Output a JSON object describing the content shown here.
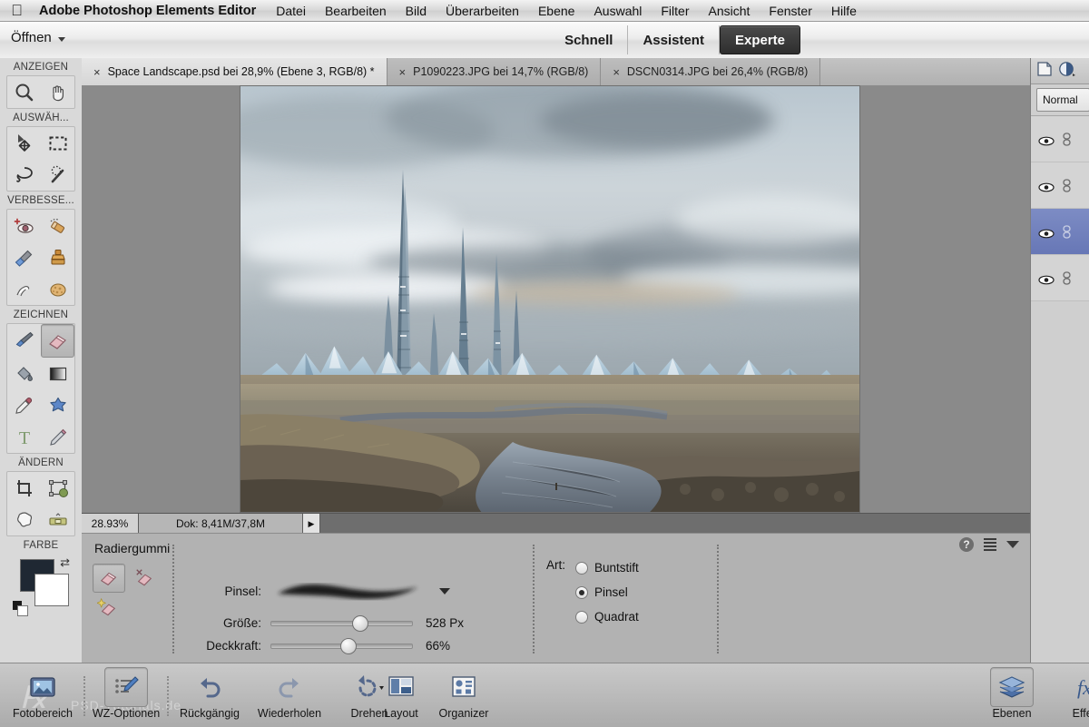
{
  "macmenu": {
    "apple_icon": "apple-icon",
    "app_name": "Adobe Photoshop Elements Editor",
    "items": [
      "Datei",
      "Bearbeiten",
      "Bild",
      "Überarbeiten",
      "Ebene",
      "Auswahl",
      "Filter",
      "Ansicht",
      "Fenster",
      "Hilfe"
    ]
  },
  "modebar": {
    "open_label": "Öffnen",
    "modes": [
      {
        "label": "Schnell",
        "active": false
      },
      {
        "label": "Assistent",
        "active": false
      },
      {
        "label": "Experte",
        "active": true
      }
    ]
  },
  "tabs": [
    {
      "close": "×",
      "label": "Space Landscape.psd bei 28,9% (Ebene 3, RGB/8) *",
      "active": true
    },
    {
      "close": "×",
      "label": "P1090223.JPG bei 14,7% (RGB/8)",
      "active": false
    },
    {
      "close": "×",
      "label": "DSCN0314.JPG bei 26,4% (RGB/8)",
      "active": false
    }
  ],
  "toolbox": {
    "sections": [
      {
        "title": "ANZEIGEN",
        "tools": [
          {
            "name": "zoom-tool",
            "selected": false
          },
          {
            "name": "hand-tool",
            "selected": false
          }
        ]
      },
      {
        "title": "AUSWÄH...",
        "tools": [
          {
            "name": "move-tool",
            "selected": false
          },
          {
            "name": "rectangular-marquee-tool",
            "selected": false
          },
          {
            "name": "lasso-tool",
            "selected": false
          },
          {
            "name": "magic-wand-tool",
            "selected": false
          }
        ]
      },
      {
        "title": "VERBESSE...",
        "tools": [
          {
            "name": "red-eye-tool",
            "selected": false
          },
          {
            "name": "spot-healing-tool",
            "selected": false
          },
          {
            "name": "smart-brush-tool",
            "selected": false
          },
          {
            "name": "clone-stamp-tool",
            "selected": false
          },
          {
            "name": "blur-tool",
            "selected": false
          },
          {
            "name": "sponge-tool",
            "selected": false
          }
        ]
      },
      {
        "title": "ZEICHNEN",
        "tools": [
          {
            "name": "brush-tool",
            "selected": false
          },
          {
            "name": "eraser-tool",
            "selected": true
          },
          {
            "name": "paint-bucket-tool",
            "selected": false
          },
          {
            "name": "gradient-tool",
            "selected": false
          },
          {
            "name": "eyedropper-tool",
            "selected": false
          },
          {
            "name": "custom-shape-tool",
            "selected": false
          },
          {
            "name": "type-tool",
            "selected": false
          },
          {
            "name": "pencil-tool",
            "selected": false
          }
        ]
      },
      {
        "title": "ÄNDERN",
        "tools": [
          {
            "name": "crop-tool",
            "selected": false
          },
          {
            "name": "recompose-tool",
            "selected": false
          },
          {
            "name": "cookie-cutter-tool",
            "selected": false
          },
          {
            "name": "straighten-tool",
            "selected": false
          }
        ]
      }
    ],
    "color_section_title": "FARBE",
    "foreground_color": "#1f2833",
    "background_color": "#ffffff",
    "swap_icon": "swap-colors-icon",
    "default_colors_icon": "default-colors-icon"
  },
  "statusbar": {
    "zoom": "28.93%",
    "doc_info": "Dok: 8,41M/37,8M",
    "expand_icon": "play-arrow-icon"
  },
  "options": {
    "title": "Radiergummi",
    "mode_icons": [
      {
        "name": "eraser-mode-icon",
        "selected": true
      },
      {
        "name": "background-eraser-mode-icon",
        "selected": false
      },
      {
        "name": "magic-eraser-mode-icon",
        "selected": false
      }
    ],
    "brush_label": "Pinsel:",
    "brush_dropdown_icon": "chevron-down-icon",
    "size_label": "Größe:",
    "size_value": "528 Px",
    "size_percent": 62,
    "opacity_label": "Deckkraft:",
    "opacity_value": "66%",
    "opacity_percent": 56,
    "art_label": "Art:",
    "art_options": [
      {
        "label": "Buntstift",
        "checked": false
      },
      {
        "label": "Pinsel",
        "checked": true
      },
      {
        "label": "Quadrat",
        "checked": false
      }
    ],
    "panel_icons": [
      {
        "name": "help-icon",
        "glyph": "?"
      },
      {
        "name": "panel-menu-icon"
      },
      {
        "name": "collapse-chevron-icon"
      }
    ]
  },
  "layers": {
    "new_layer_icon": "new-layer-icon",
    "adjustment-layer_icon": "adjustment-layer-icon",
    "blend_mode": "Normal",
    "rows": [
      {
        "name": "layer-row-1",
        "visible": true,
        "linked": true,
        "selected": false
      },
      {
        "name": "layer-row-2",
        "visible": true,
        "linked": true,
        "selected": false
      },
      {
        "name": "layer-row-3",
        "visible": true,
        "linked": true,
        "selected": true
      },
      {
        "name": "layer-row-4",
        "visible": true,
        "linked": true,
        "selected": false
      }
    ]
  },
  "taskbar": {
    "left_items": [
      {
        "label": "Fotobereich",
        "icon": "photo-bin-icon",
        "selected": false
      },
      {
        "label": "WZ-Optionen",
        "icon": "tool-options-icon",
        "selected": true
      },
      {
        "label": "Rückgängig",
        "icon": "undo-icon",
        "selected": false
      },
      {
        "label": "Wiederholen",
        "icon": "redo-icon",
        "selected": false
      },
      {
        "label": "Drehen",
        "icon": "rotate-icon",
        "selected": false
      },
      {
        "label": "Layout",
        "icon": "layout-icon",
        "selected": false
      },
      {
        "label": "Organizer",
        "icon": "organizer-icon",
        "selected": false
      }
    ],
    "right_items": [
      {
        "label": "Ebenen",
        "icon": "layers-icon",
        "selected": true
      },
      {
        "label": "Effekte",
        "icon": "fx-icon",
        "selected": false
      }
    ]
  },
  "canvas": {
    "document_name": "Space Landscape.psd",
    "brush_cursor_icon": "brush-cursor-circle"
  }
}
